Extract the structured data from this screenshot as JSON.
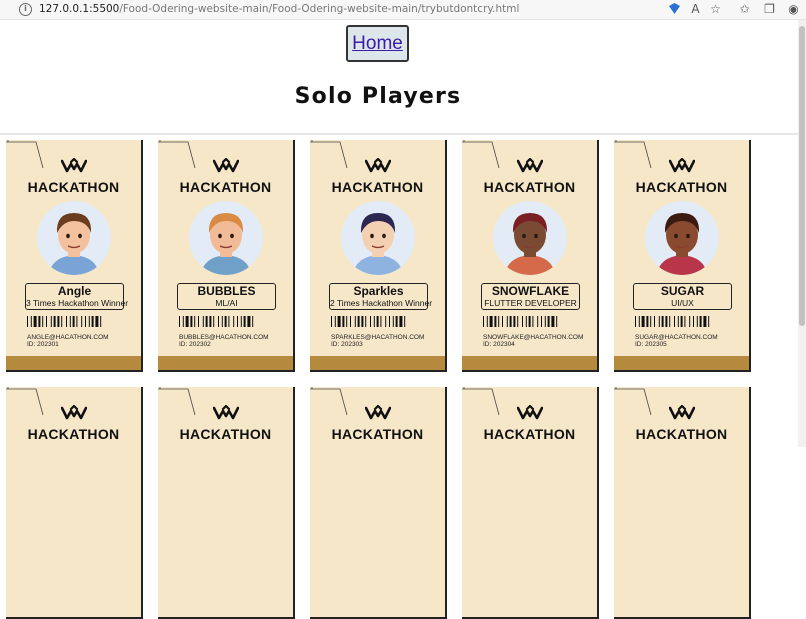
{
  "browser": {
    "url_host": "127.0.0.1:5500",
    "url_path": "/Food-Odering-website-main/Food-Odering-website-main/trybutdontcry.html"
  },
  "page": {
    "home_label": "Home",
    "title": "Solo Players"
  },
  "cards": [
    {
      "brand": "HACKATHON",
      "name": "Angle",
      "role": "3 Times Hackathon Winner",
      "email": "ANGLE@HACATHON.COM",
      "id": "ID: 202301",
      "hair": "#6b3d1e",
      "skin": "#f3c19e",
      "shirt": "#7aa4d6"
    },
    {
      "brand": "HACKATHON",
      "name": "BUBBLES",
      "role": "ML/AI",
      "email": "BUBBLES@HACATHON.COM",
      "id": "ID: 202302",
      "hair": "#d98a45",
      "skin": "#f2bb98",
      "shirt": "#6fa0c8"
    },
    {
      "brand": "HACKATHON",
      "name": "Sparkles",
      "role": "2 Times Hackathon Winner",
      "email": "SPARKLES@HACATHON.COM",
      "id": "ID: 202303",
      "hair": "#2c2650",
      "skin": "#f4d0b3",
      "shirt": "#8fb3e0"
    },
    {
      "brand": "HACKATHON",
      "name": "SNOWFLAKE",
      "role": "FLUTTER DEVELOPER",
      "email": "SNOWFLAKE@HACATHON.COM",
      "id": "ID: 202304",
      "hair": "#7a1f24",
      "skin": "#7a4a33",
      "shirt": "#d56a4a"
    },
    {
      "brand": "HACKATHON",
      "name": "SUGAR",
      "role": "UI/UX",
      "email": "SUGAR@HACATHON.COM",
      "id": "ID: 202305",
      "hair": "#3b1a12",
      "skin": "#8a4a30",
      "shirt": "#b9354a"
    }
  ],
  "second_row": [
    {
      "brand": "HACKATHON"
    },
    {
      "brand": "HACKATHON"
    },
    {
      "brand": "HACKATHON"
    },
    {
      "brand": "HACKATHON"
    },
    {
      "brand": "HACKATHON"
    }
  ],
  "colors": {
    "card_bg": "#f6e7c9",
    "strip": "#b5893e",
    "home_bg": "#dde6ea",
    "home_link": "#3a1ca8"
  }
}
